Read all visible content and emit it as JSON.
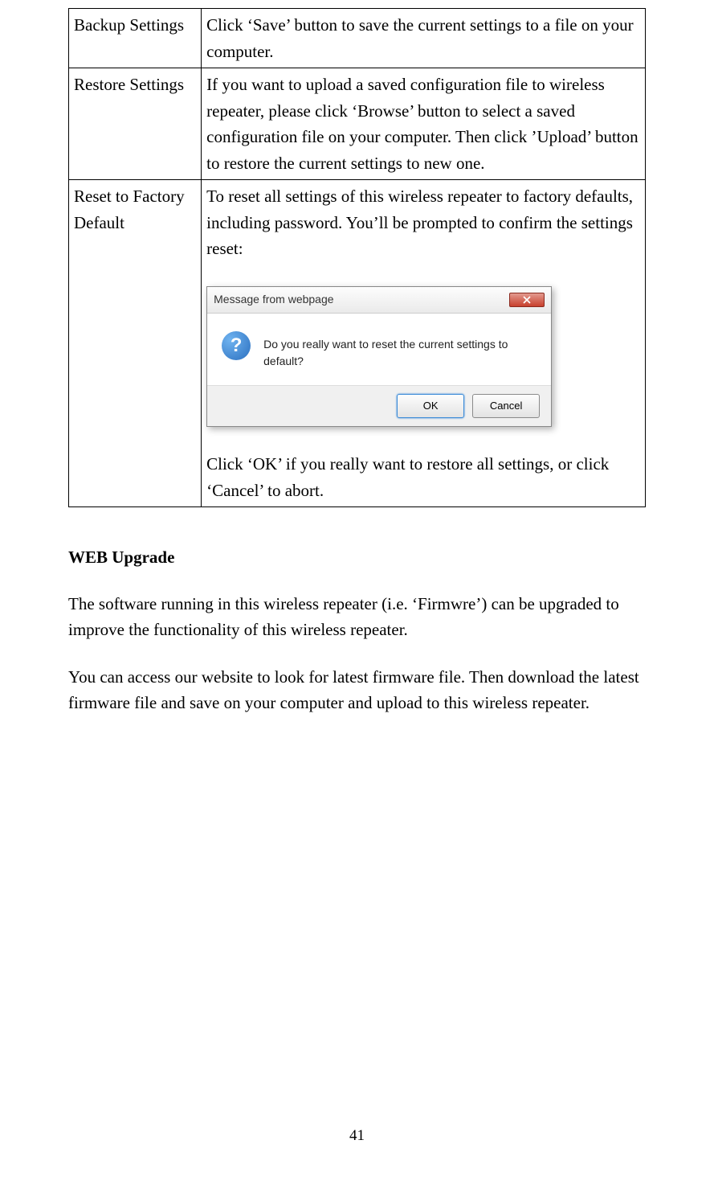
{
  "table": {
    "rows": [
      {
        "label": "Backup Settings",
        "desc": "Click ‘Save’ button to save the current settings to a file on your computer."
      },
      {
        "label": "Restore Settings",
        "desc": "If you want to upload a saved configuration file to wireless repeater, please click ‘Browse’ button to select a saved configuration file on your computer. Then click ’Upload’ button to restore the current settings to new one."
      },
      {
        "label": "Reset to Factory Default",
        "desc_top": "To reset all settings of this wireless repeater to factory defaults, including password. You’ll be prompted to confirm the settings reset:",
        "desc_bottom": "Click ‘OK’ if you really want to restore all settings, or click ‘Cancel’ to abort."
      }
    ]
  },
  "dialog": {
    "title": "Message from webpage",
    "message": "Do you really want to reset the current settings to default?",
    "ok": "OK",
    "cancel": "Cancel"
  },
  "section": {
    "heading": "WEB Upgrade",
    "para1": "The software running in this wireless repeater (i.e. ‘Firmwre’) can be upgraded to improve the functionality of this wireless repeater.",
    "para2": "You can access our website to look for latest firmware file. Then download the latest firmware file and save on your computer and upload to this wireless repeater."
  },
  "page_number": "41"
}
